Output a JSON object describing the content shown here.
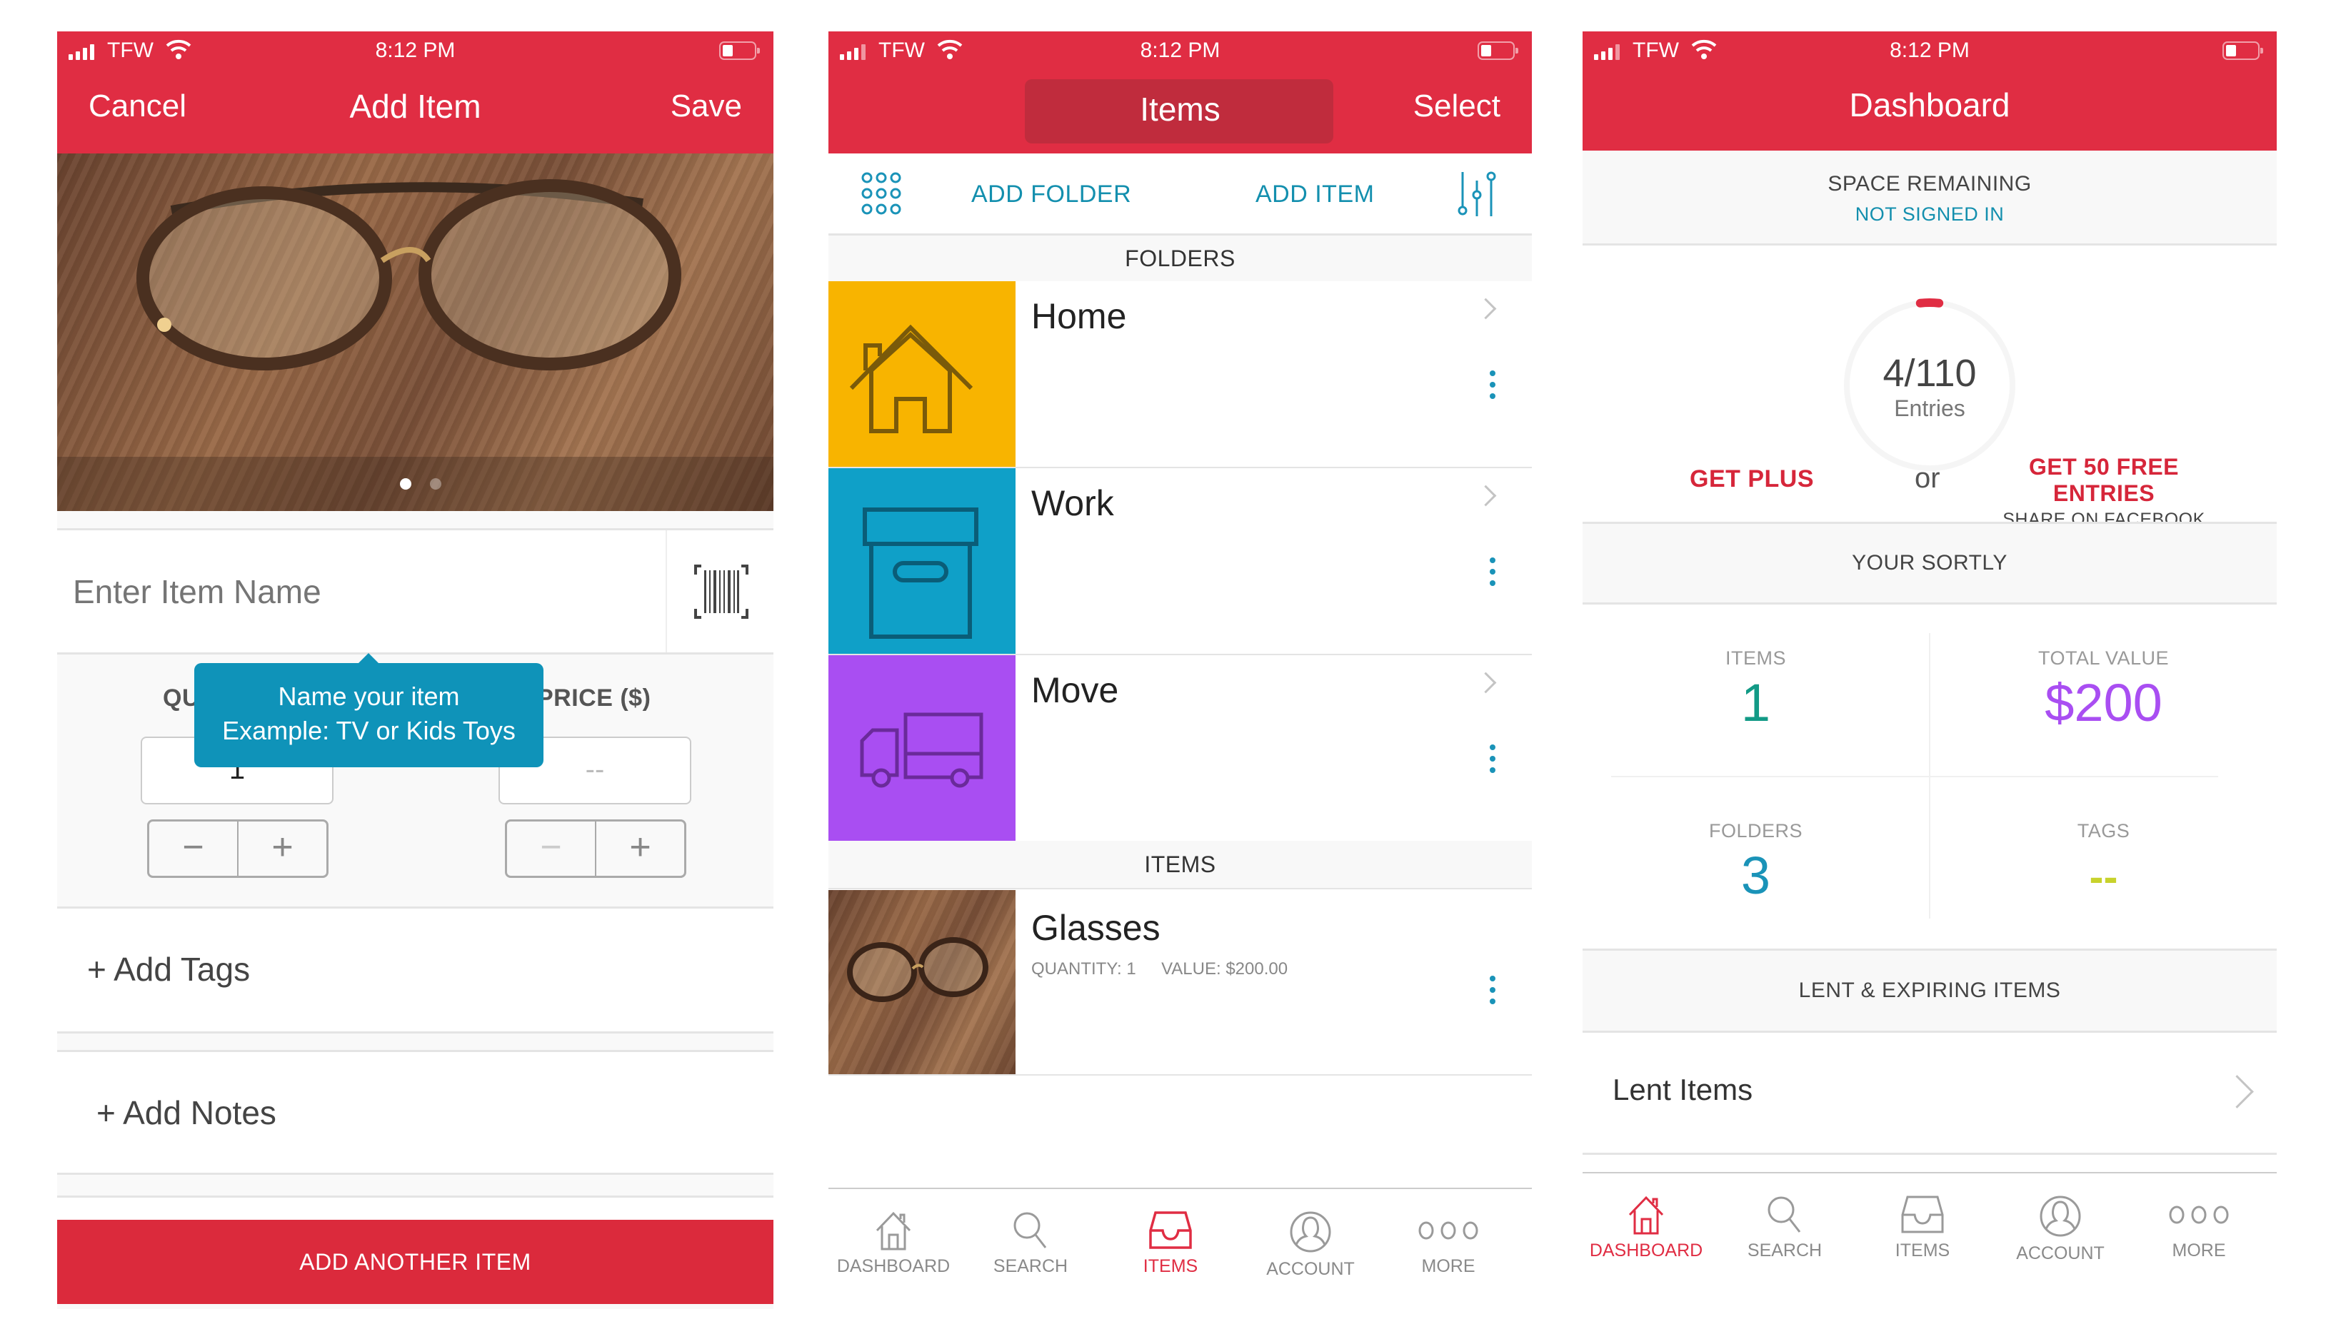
{
  "status_bar": {
    "carrier": "TFW",
    "time": "8:12 PM"
  },
  "colors": {
    "brand_red": "#e02d43",
    "teal": "#138fae",
    "folder_home": "#f8b400",
    "folder_work": "#0fa0c8",
    "folder_move": "#a94ef2",
    "value_purple": "#a94ef2",
    "items_green": "#129a86",
    "tags_yellow": "#c8d22c"
  },
  "add_item_screen": {
    "nav": {
      "cancel": "Cancel",
      "title": "Add Item",
      "save": "Save"
    },
    "photo_pages": {
      "current": 1,
      "total": 2
    },
    "name_field": {
      "placeholder": "Enter Item Name",
      "value": ""
    },
    "barcode_icon": "barcode-scan-icon",
    "tooltip": {
      "line1": "Name your item",
      "line2": "Example: TV or Kids Toys"
    },
    "quantity": {
      "label": "QUANTITY",
      "label_visible": "QU",
      "value": "1"
    },
    "price": {
      "label": "PRICE ($)",
      "label_visible": "PRICE ($)",
      "value": "--"
    },
    "stepper": {
      "minus": "−",
      "plus": "+"
    },
    "add_tags": "+ Add Tags",
    "add_notes": "+ Add Notes",
    "add_another": "ADD ANOTHER ITEM"
  },
  "items_screen": {
    "nav": {
      "title": "Items",
      "select": "Select"
    },
    "toolbar": {
      "add_folder": "ADD FOLDER",
      "add_item": "ADD ITEM"
    },
    "folders_header": "FOLDERS",
    "folders": [
      {
        "name": "Home",
        "icon": "house-icon"
      },
      {
        "name": "Work",
        "icon": "box-icon"
      },
      {
        "name": "Move",
        "icon": "truck-icon"
      }
    ],
    "items_header": "ITEMS",
    "items": [
      {
        "name": "Glasses",
        "quantity_label": "QUANTITY:",
        "quantity": "1",
        "value_label": "VALUE:",
        "value": "$200.00"
      }
    ],
    "tabs": [
      {
        "label": "DASHBOARD",
        "icon": "home-icon",
        "active": false
      },
      {
        "label": "SEARCH",
        "icon": "search-icon",
        "active": false
      },
      {
        "label": "ITEMS",
        "icon": "inbox-tray-icon",
        "active": true
      },
      {
        "label": "ACCOUNT",
        "icon": "account-icon",
        "active": false
      },
      {
        "label": "MORE",
        "icon": "more-dots-icon",
        "active": false
      }
    ]
  },
  "dashboard_screen": {
    "nav": {
      "title": "Dashboard"
    },
    "space_remaining": {
      "label": "SPACE REMAINING",
      "status": "NOT SIGNED IN"
    },
    "entries": {
      "used": 4,
      "total": 110,
      "text": "4/110",
      "label": "Entries"
    },
    "get_plus": "GET PLUS",
    "or": "or",
    "free_entries": {
      "title": "GET 50 FREE ENTRIES",
      "subtitle": "SHARE ON FACEBOOK"
    },
    "your_sortly": "YOUR SORTLY",
    "stats": [
      {
        "label": "ITEMS",
        "value": "1"
      },
      {
        "label": "TOTAL VALUE",
        "value": "$200"
      },
      {
        "label": "FOLDERS",
        "value": "3"
      },
      {
        "label": "TAGS",
        "value": "--"
      }
    ],
    "lent_header": "LENT & EXPIRING ITEMS",
    "lent_items": "Lent Items",
    "tabs": [
      {
        "label": "DASHBOARD",
        "icon": "home-icon",
        "active": true
      },
      {
        "label": "SEARCH",
        "icon": "search-icon",
        "active": false
      },
      {
        "label": "ITEMS",
        "icon": "inbox-tray-icon",
        "active": false
      },
      {
        "label": "ACCOUNT",
        "icon": "account-icon",
        "active": false
      },
      {
        "label": "MORE",
        "icon": "more-dots-icon",
        "active": false
      }
    ]
  }
}
